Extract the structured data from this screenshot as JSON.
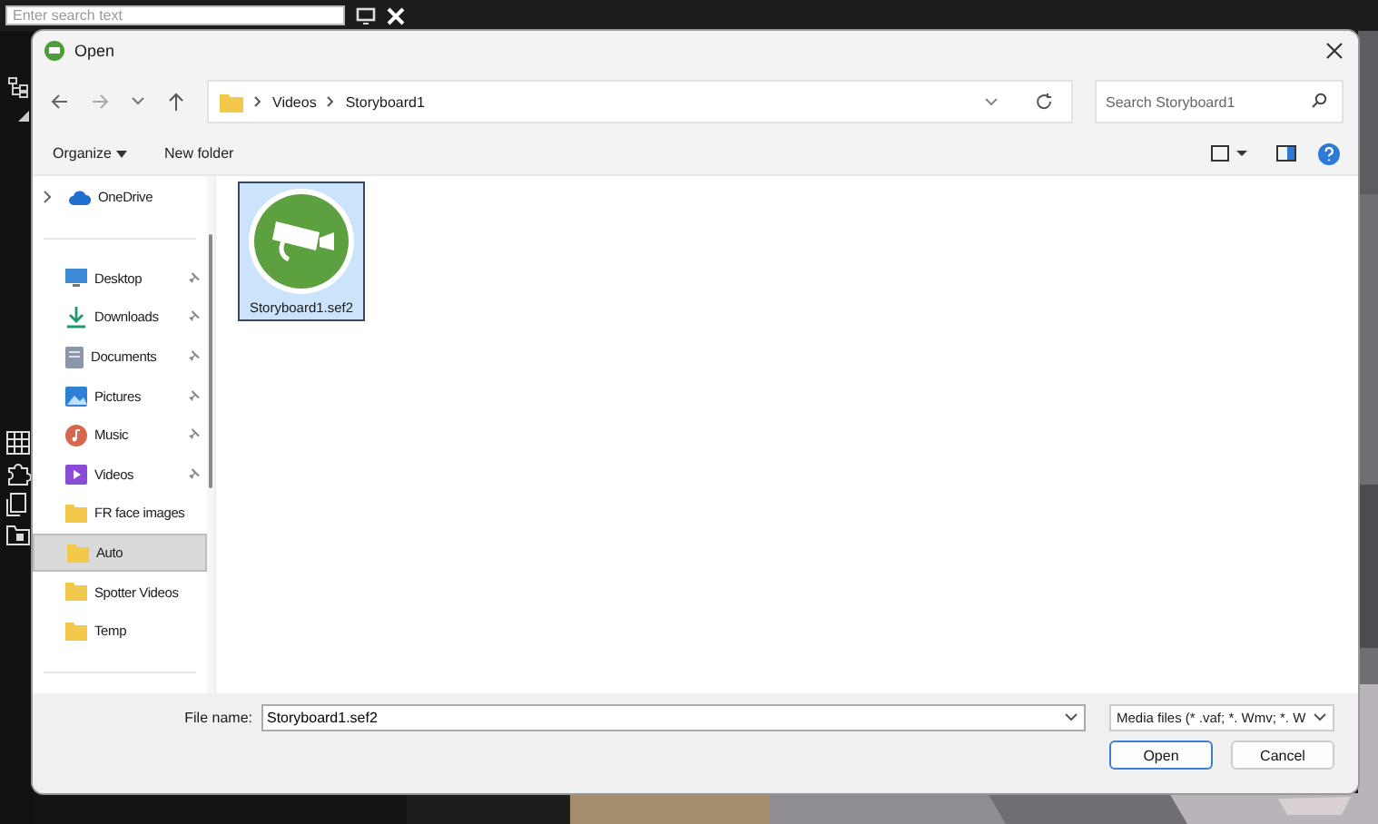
{
  "background": {
    "search": {
      "placeholder": "Enter search text"
    }
  },
  "dialog": {
    "title": "Open",
    "breadcrumb": [
      "Videos",
      "Storyboard1"
    ],
    "search": {
      "placeholder": "Search Storyboard1"
    },
    "toolbar": {
      "organize": "Organize",
      "new_folder": "New folder"
    },
    "nav_groups": [
      [
        {
          "label": "OneDrive",
          "kind": "cloud",
          "expanded": false,
          "pinned": false,
          "selected": false
        }
      ],
      [
        {
          "label": "Desktop",
          "kind": "desktop",
          "pinned": true,
          "selected": false
        },
        {
          "label": "Downloads",
          "kind": "download",
          "pinned": true,
          "selected": false
        },
        {
          "label": "Documents",
          "kind": "documents",
          "pinned": true,
          "selected": false
        },
        {
          "label": "Pictures",
          "kind": "pictures",
          "pinned": true,
          "selected": false
        },
        {
          "label": "Music",
          "kind": "music",
          "pinned": true,
          "selected": false
        },
        {
          "label": "Videos",
          "kind": "videos",
          "pinned": true,
          "selected": false
        },
        {
          "label": "FR face images",
          "kind": "folder",
          "pinned": false,
          "selected": false
        },
        {
          "label": "Auto",
          "kind": "folder",
          "pinned": false,
          "selected": true
        },
        {
          "label": "Spotter Videos",
          "kind": "folder",
          "pinned": false,
          "selected": false
        },
        {
          "label": "Temp",
          "kind": "folder",
          "pinned": false,
          "selected": false
        }
      ]
    ],
    "files": [
      {
        "name": "Storyboard1.sef2",
        "selected": true
      }
    ],
    "file_name": {
      "label": "File name:",
      "value": "Storyboard1.sef2"
    },
    "file_type": "Media files (* .vaf; *. Wmv; *. W",
    "buttons": [
      {
        "label": "Open",
        "default": true
      },
      {
        "label": "Cancel",
        "default": false
      }
    ]
  }
}
